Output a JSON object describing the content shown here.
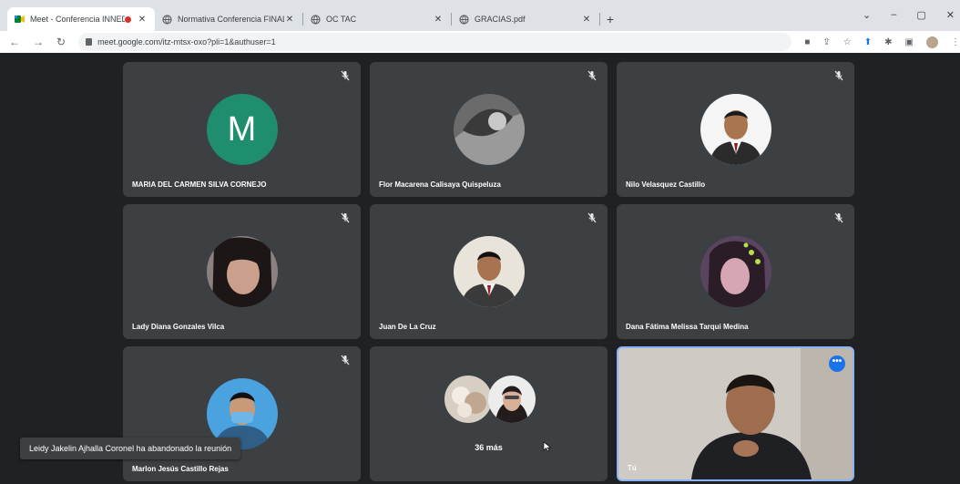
{
  "browser": {
    "tabs": [
      {
        "title": "Meet - Conferencia INNEDIT",
        "recording": true,
        "active": true
      },
      {
        "title": "Normativa Conferencia FINAL.pc"
      },
      {
        "title": "OC TAC"
      },
      {
        "title": "GRACIAS.pdf"
      }
    ],
    "new_tab": "+",
    "url": "meet.google.com/itz-mtsx-oxo?pli=1&authuser=1",
    "window_controls": [
      "⌄",
      "–",
      "▢",
      "✕"
    ]
  },
  "meeting": {
    "participants": [
      {
        "name": "MARIA DEL CARMEN SILVA CORNEJO",
        "initial": "M",
        "avatar_color": "#1e8e6e",
        "muted": true
      },
      {
        "name": "Flor Macarena Calisaya Quispeluza",
        "muted": true
      },
      {
        "name": "Nilo Velasquez Castillo",
        "muted": true
      },
      {
        "name": "Lady Diana Gonzales Vilca",
        "muted": true
      },
      {
        "name": "Juan De La Cruz",
        "muted": true
      },
      {
        "name": "Dana Fátima Melissa Tarqui Medina",
        "muted": true
      },
      {
        "name": "Marlon Jesús Castillo Rejas",
        "muted": true
      }
    ],
    "overflow_label": "36 más",
    "self_label": "Tú",
    "notification": "Leidy Jakelin Ajhalla Coronel ha abandonado la reunión"
  },
  "colors": {
    "accent": "#1a73e8",
    "tile_bg": "#3c4043",
    "page_bg": "#202124",
    "self_border": "#8ab4f8"
  }
}
